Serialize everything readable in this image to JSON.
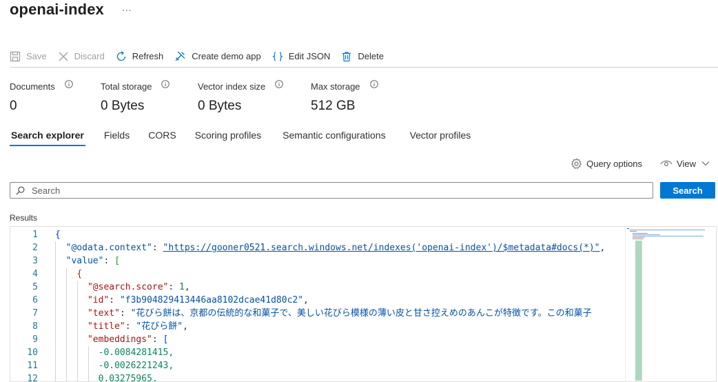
{
  "header": {
    "title": "openai-index",
    "more": "···"
  },
  "toolbar": {
    "save": "Save",
    "discard": "Discard",
    "refresh": "Refresh",
    "create_demo": "Create demo app",
    "edit_json": "Edit JSON",
    "delete": "Delete"
  },
  "stats": [
    {
      "label": "Documents",
      "value": "0"
    },
    {
      "label": "Total storage",
      "value": "0 Bytes"
    },
    {
      "label": "Vector index size",
      "value": "0 Bytes"
    },
    {
      "label": "Max storage",
      "value": "512 GB"
    }
  ],
  "tabs": [
    "Search explorer",
    "Fields",
    "CORS",
    "Scoring profiles",
    "Semantic configurations",
    "Vector profiles"
  ],
  "options": {
    "query_options": "Query options",
    "view": "View"
  },
  "search": {
    "placeholder": "Search",
    "button": "Search"
  },
  "results": {
    "label": "Results",
    "line_numbers": [
      "1",
      "2",
      "3",
      "4",
      "5",
      "6",
      "7",
      "8",
      "9",
      "10",
      "11",
      "12"
    ],
    "odata_key": "\"@odata.context\"",
    "odata_url": "\"https://gooner0521.search.windows.net/indexes('openai-index')/$metadata#docs(*)\"",
    "value_key": "\"value\"",
    "score_key": "\"@search.score\"",
    "score_value": "1",
    "id_key": "\"id\"",
    "id_value": "\"f3b904829413446aa8102dcae41d80c2\"",
    "text_key": "\"text\"",
    "text_value": "\"花びら餅は、京都の伝統的な和菓子で、美しい花びら模様の薄い皮と甘さ控えめのあんこが特徴です。この和菓子",
    "title_key": "\"title\"",
    "title_value": "\"花びら餅\"",
    "emb_key": "\"embeddings\"",
    "emb_values": [
      "-0.0084281415,",
      "-0.0026221243,",
      "0.03275965,"
    ]
  },
  "colors": {
    "accent": "#0078d4",
    "json_key": "#a31515",
    "json_string": "#0451a5",
    "json_number": "#098658"
  }
}
